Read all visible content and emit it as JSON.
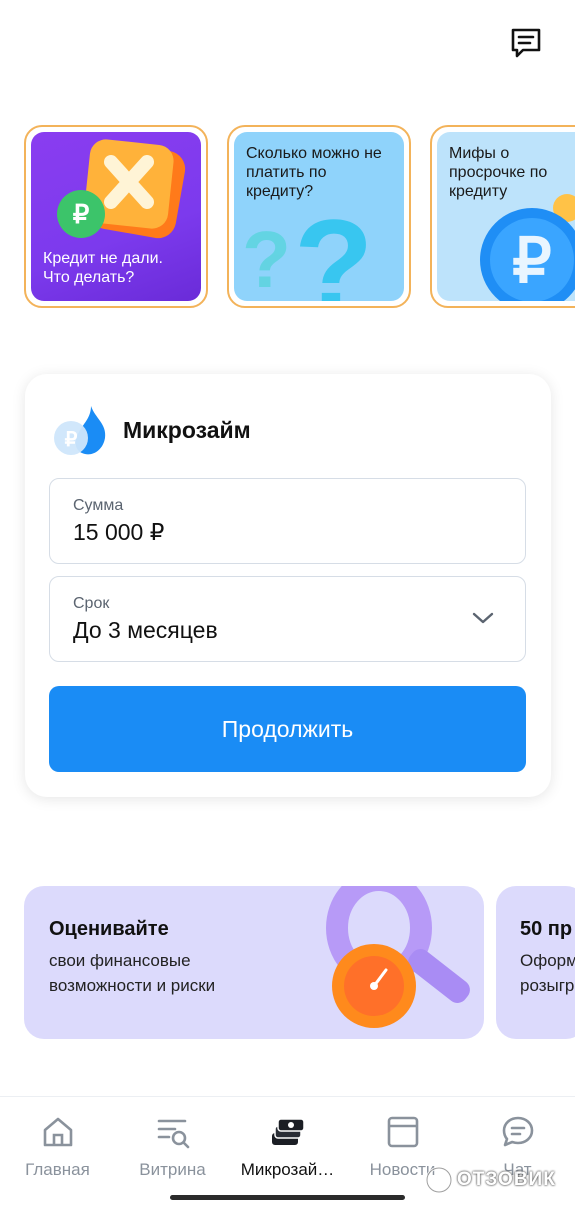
{
  "stories": [
    {
      "title": "Кредит не дали. Что делать?"
    },
    {
      "title": "Сколько можно не платить по кредиту?"
    },
    {
      "title": "Мифы о просрочке по кредиту"
    }
  ],
  "loan": {
    "title": "Микрозайм",
    "amount_label": "Сумма",
    "amount_value": "15 000 ₽",
    "term_label": "Срок",
    "term_value": "До 3 месяцев",
    "continue_label": "Продолжить"
  },
  "promos": [
    {
      "title": "Оценивайте",
      "subtitle": "свои финансовые возможности и риски"
    },
    {
      "title": "50 пр",
      "subtitle": "Оформ\nрозыгр"
    }
  ],
  "nav": [
    {
      "label": "Главная",
      "icon": "home-icon"
    },
    {
      "label": "Витрина",
      "icon": "showcase-search-icon"
    },
    {
      "label": "Микрозай…",
      "icon": "money-stack-icon"
    },
    {
      "label": "Новости",
      "icon": "news-icon"
    },
    {
      "label": "Чат",
      "icon": "chat-icon"
    }
  ],
  "watermark": "ОТЗОВИК",
  "colors": {
    "accent": "#1a8cf5",
    "story_border": "#f3b35a",
    "promo_bg": "#dcdafc"
  }
}
